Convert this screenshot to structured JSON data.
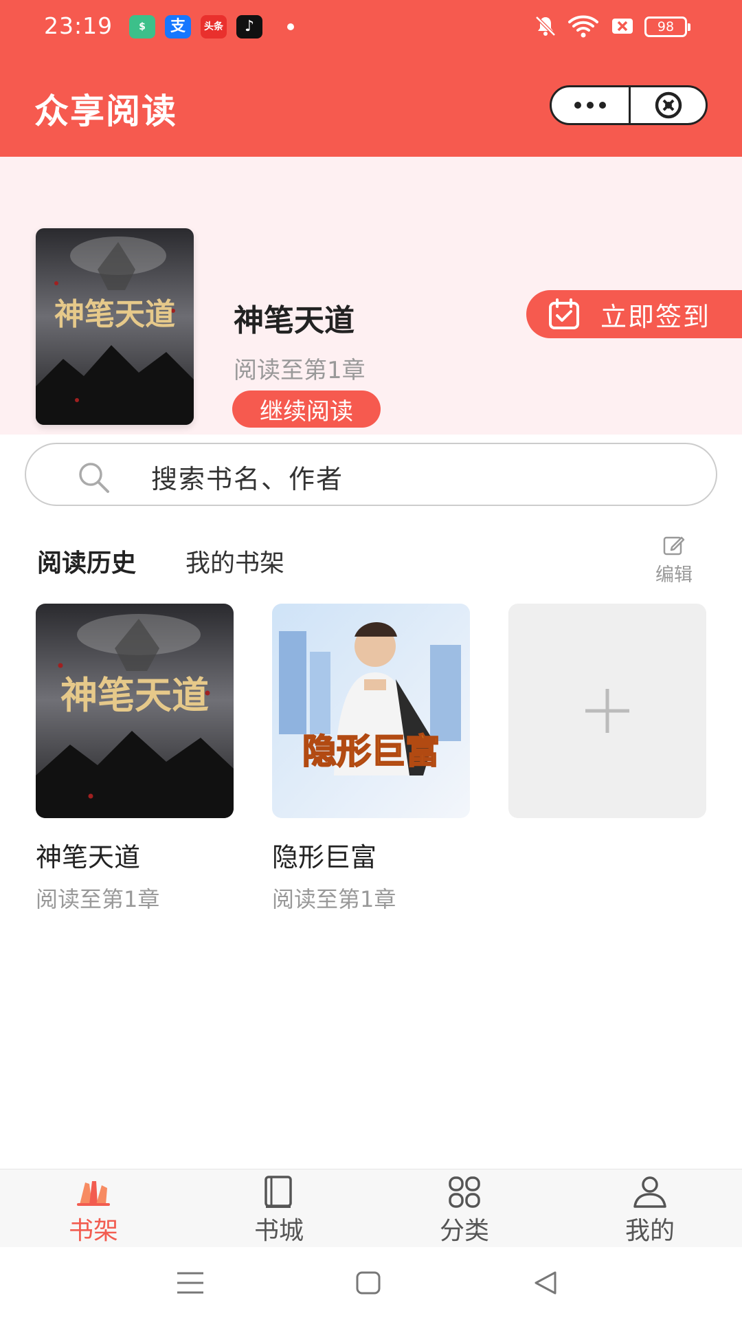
{
  "status_bar": {
    "time": "23:19",
    "apps": [
      {
        "name": "security-app-icon",
        "glyph": "$",
        "color": "#3cc08a"
      },
      {
        "name": "alipay-app-icon",
        "glyph": "支",
        "color": "#1677ff"
      },
      {
        "name": "toutiao-app-icon",
        "glyph": "头条",
        "color": "#e9302d"
      },
      {
        "name": "tiktok-app-icon",
        "glyph": "♪",
        "color": "#111111"
      }
    ],
    "battery": "98"
  },
  "header": {
    "title": "众享阅读"
  },
  "featured": {
    "title": "神笔天道",
    "progress": "阅读至第1章",
    "continue_label": "继续阅读",
    "signin_label": "立即签到"
  },
  "search": {
    "placeholder": "搜索书名、作者"
  },
  "tabs": {
    "history": "阅读历史",
    "shelf": "我的书架",
    "edit": "编辑"
  },
  "books": [
    {
      "title": "神笔天道",
      "progress": "阅读至第1章"
    },
    {
      "title": "隐形巨富",
      "progress": "阅读至第1章"
    }
  ],
  "tabbar": {
    "items": [
      {
        "label": "书架",
        "icon": "bookshelf-icon"
      },
      {
        "label": "书城",
        "icon": "book-icon"
      },
      {
        "label": "分类",
        "icon": "category-icon"
      },
      {
        "label": "我的",
        "icon": "profile-icon"
      }
    ],
    "active_index": 0
  },
  "colors": {
    "brand": "#f65a4f",
    "featured_bg": "#fef0f2"
  }
}
